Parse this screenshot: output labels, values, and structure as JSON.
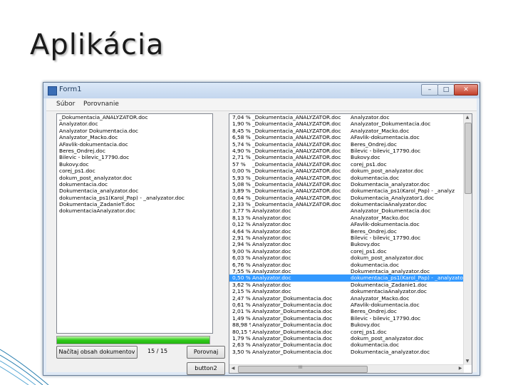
{
  "slide": {
    "title": "Aplikácia"
  },
  "window": {
    "title": "Form1",
    "controls": {
      "minimize": "–",
      "maximize": "□",
      "close": "✕"
    },
    "menu": [
      "Súbor",
      "Porovnanie"
    ],
    "file_list": [
      "_Dokumentacia_ANALYZATOR.doc",
      "Analyzator.doc",
      "Analyzator Dokumentacia.doc",
      "Analyzator_Macko.doc",
      "AFavlik-dokumentacia.doc",
      "Beres_Ondrej.doc",
      "Bilevic - bilevic_17790.doc",
      "Bukovy.doc",
      "corej_ps1.doc",
      "dokum_post_analyzator.doc",
      "dokumentacia.doc",
      "Dokumentacia_analyzator.doc",
      "dokumentacia_ps1(Karol_Pap) - _analyzator.doc",
      "Dokumentacia_ZadanieT.doc",
      "dokumentaciaAnalyzator.doc"
    ],
    "progress": 1.0,
    "load_button": "Načítaj obsah dokumentov",
    "count": "15 / 15",
    "compare_button": "Porovnaj",
    "button2": "button2",
    "results": [
      [
        "7,04 %",
        "_Dokumentacia_ANALYZATOR.doc",
        "Analyzator.doc"
      ],
      [
        "1,90 %",
        "_Dokumentacia_ANALYZATOR.doc",
        "Analyzator_Dokumentacia.doc"
      ],
      [
        "8,45 %",
        "_Dokumentacia_ANALYZATOR.doc",
        "Analyzator_Macko.doc"
      ],
      [
        "6,58 %",
        "_Dokumentacia_ANALYZATOR.doc",
        "AFavlik-dokumentacia.doc"
      ],
      [
        "5,74 %",
        "_Dokumentacia_ANALYZATOR.doc",
        "Beres_Ondrej.doc"
      ],
      [
        "4,90 %",
        "_Dokumentacia_ANALYZATOR.doc",
        "Bilevic - bilevic_17790.doc"
      ],
      [
        "2,71 %",
        "_Dokumentacia_ANALYZATOR.doc",
        "Bukovy.doc"
      ],
      [
        "57 %",
        "_Dokumentacia_ANALYZATOR.doc",
        "corej_ps1.doc"
      ],
      [
        "0,00 %",
        "_Dokumentacia_ANALYZATOR.doc",
        "dokum_post_analyzator.doc"
      ],
      [
        "5,93 %",
        "_Dokumentacia_ANALYZATOR.doc",
        "dokumentacia.doc"
      ],
      [
        "5,08 %",
        "_Dokumentacia_ANALYZATOR.doc",
        "Dokumentacia_analyzator.doc"
      ],
      [
        "3,89 %",
        "_Dokumentacia_ANALYZATOR.doc",
        "dokumentacia_ps1(Karol_Pap) - _analyz"
      ],
      [
        "0,64 %",
        "_Dokumentacia_ANALYZATOR.doc",
        "Dokumentacia_Analyzator1.doc"
      ],
      [
        "2,33 %",
        "_Dokumentacia_ANALYZATOR.doc",
        "dokumentaciaAnalyzator.doc"
      ],
      [
        "3,77 %",
        "Analyzator.doc",
        "Analyzator_Dokumentacia.doc"
      ],
      [
        "8,13 %",
        "Analyzator.doc",
        "Analyzator_Macko.doc"
      ],
      [
        "0,12 %",
        "Analyzator.doc",
        "AFavlik-dokumentacia.doc"
      ],
      [
        "4,64 %",
        "Analyzator.doc",
        "Beres_Ondrej.doc"
      ],
      [
        "2,91 %",
        "Analyzator.doc",
        "Bilevic - bilevic_17790.doc"
      ],
      [
        "2,94 %",
        "Analyzator.doc",
        "Bukovy.doc"
      ],
      [
        "9,00 %",
        "Analyzator.doc",
        "corej_ps1.doc"
      ],
      [
        "6,03 %",
        "Analyzator.doc",
        "dokum_post_analyzator.doc"
      ],
      [
        "6,76 %",
        "Analyzator.doc",
        "dokumentacia.doc"
      ],
      [
        "7,55 %",
        "Analyzator.doc",
        "Dokumentacia_analyzator.doc"
      ],
      [
        "0,50 %",
        "Analyzator.doc",
        "dokumentacia_ps1(Karol_Pap) - _analyzator.doc"
      ],
      [
        "3,62 %",
        "Analyzator.doc",
        "Dokumentacia_Zadanie1.doc"
      ],
      [
        "2,15 %",
        "Analyzator.doc",
        "dokumentaciaAnalyzator.doc"
      ],
      [
        "2,47 %",
        "Analyzator_Dokumentacia.doc",
        "Analyzator_Macko.doc"
      ],
      [
        "0,61 %",
        "Analyzator_Dokumentacia.doc",
        "AFavlik-dokumentacia.doc"
      ],
      [
        "2,01 %",
        "Analyzator_Dokumentacia.doc",
        "Beres_Ondrej.doc"
      ],
      [
        "1,49 %",
        "Analyzator_Dokumentacia.doc",
        "Bilevic - bilevic_17790.doc"
      ],
      [
        "88,98 %",
        "Analyzator_Dokumentacia.doc",
        "Bukovy.doc"
      ],
      [
        "80,15 %",
        "Analyzator_Dokumentacia.doc",
        "corej_ps1.doc"
      ],
      [
        "1,79 %",
        "Analyzator_Dokumentacia.doc",
        "dokum_post_analyzator.doc"
      ],
      [
        "2,63 %",
        "Analyzator_Dokumentacia.doc",
        "dokumentacia.doc"
      ],
      [
        "3,50 %",
        "Analyzator_Dokumentacia.doc",
        "Dokumentacia_analyzator.doc"
      ]
    ],
    "selected_index": 24,
    "hscroll_label": "III"
  }
}
